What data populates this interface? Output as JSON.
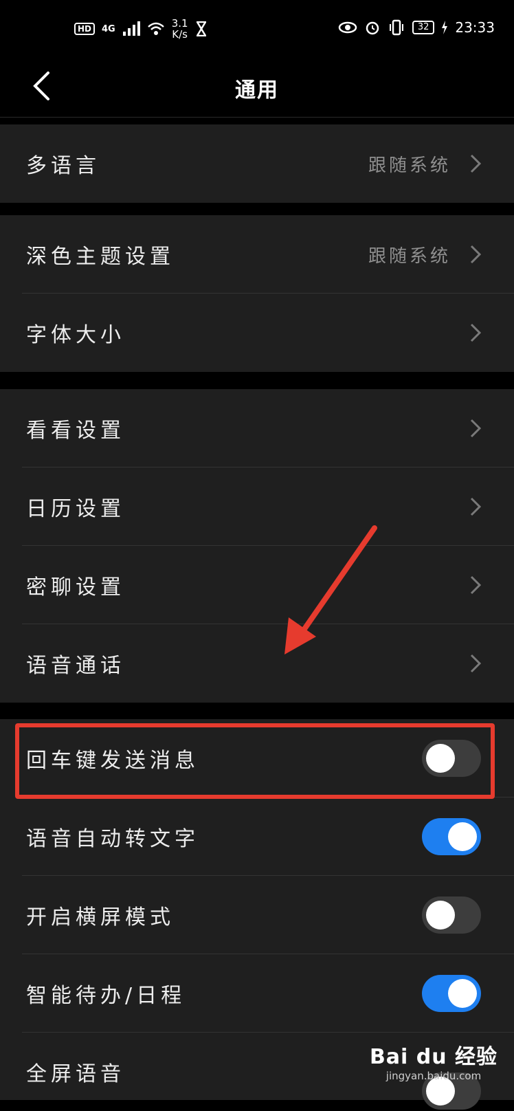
{
  "status_bar": {
    "hd": "HD",
    "network": "4G",
    "speed_value": "3.1",
    "speed_unit": "K/s",
    "battery": "32",
    "time": "23:33"
  },
  "header": {
    "title": "通用"
  },
  "groups": [
    {
      "items": [
        {
          "label": "多语言",
          "value": "跟随系统"
        }
      ]
    },
    {
      "items": [
        {
          "label": "深色主题设置",
          "value": "跟随系统"
        },
        {
          "label": "字体大小"
        }
      ]
    },
    {
      "items": [
        {
          "label": "看看设置"
        },
        {
          "label": "日历设置"
        },
        {
          "label": "密聊设置"
        },
        {
          "label": "语音通话"
        }
      ]
    },
    {
      "items": [
        {
          "label": "回车键发送消息",
          "toggle": false
        },
        {
          "label": "语音自动转文字",
          "toggle": true
        },
        {
          "label": "开启横屏模式",
          "toggle": false
        },
        {
          "label": "智能待办/日程",
          "toggle": true
        },
        {
          "label": "全屏语音",
          "toggle": false
        }
      ]
    }
  ],
  "annotation": {
    "color": "#e63b2e"
  },
  "watermark": {
    "logo": "Bai du 经验",
    "url": "jingyan.baidu.com"
  },
  "colors": {
    "toggle_on": "#1e7ff0",
    "toggle_off": "#3d3d3d",
    "background": "#000000",
    "row": "#1f1f1f"
  }
}
